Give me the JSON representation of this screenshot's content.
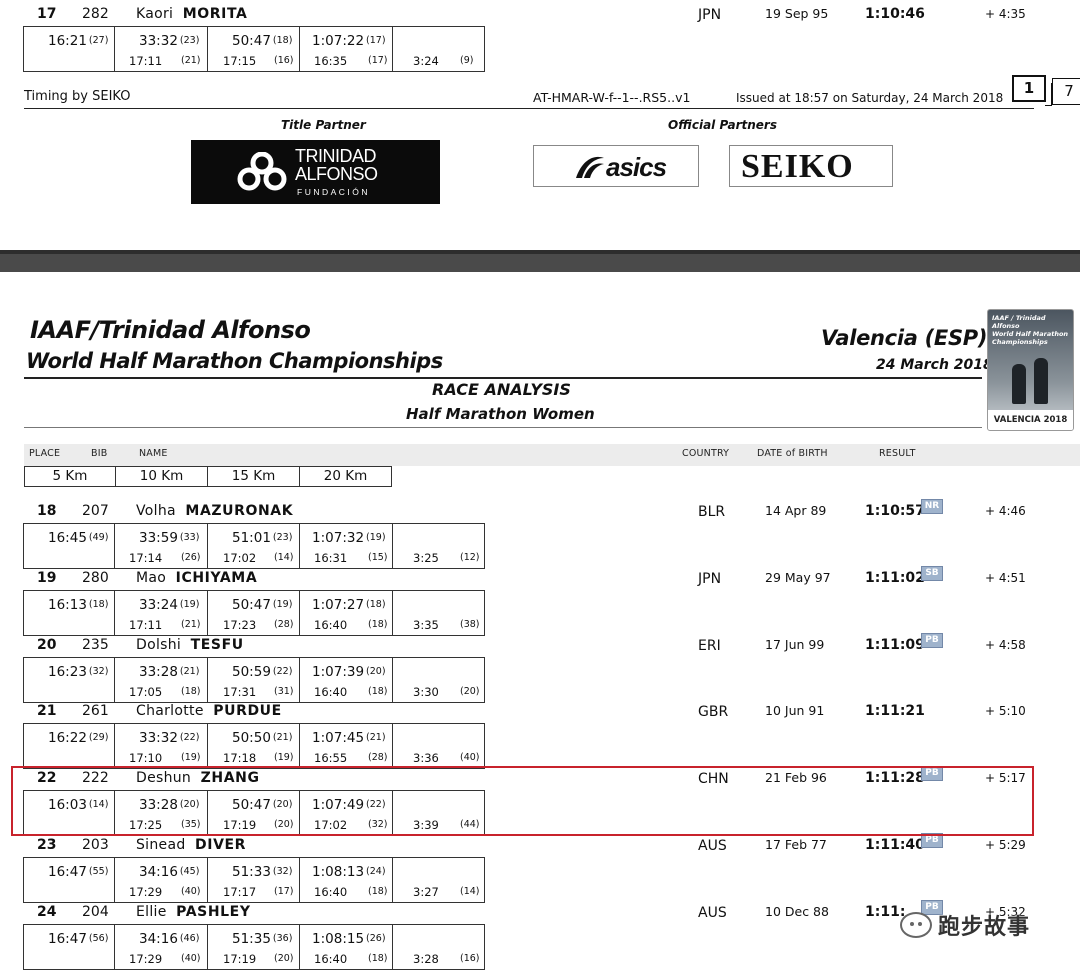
{
  "top_page": {
    "athlete": {
      "place": "17",
      "bib": "282",
      "first": "Kaori",
      "last": "MORITA",
      "country": "JPN",
      "dob": "19 Sep 95",
      "result": "1:10:46",
      "badge": "",
      "behind": "+ 4:35",
      "s5": "16:21",
      "r5": "(27)",
      "s10": "33:32",
      "r10": "(23)",
      "s15": "50:47",
      "r15": "(18)",
      "s20": "1:07:22",
      "r20": "(17)",
      "l10": "17:11",
      "lr10": "(21)",
      "l15": "17:15",
      "lr15": "(16)",
      "l20": "16:35",
      "lr20": "(17)",
      "lf": "3:24",
      "lrf": "(9)"
    },
    "footer": {
      "timing": "Timing by SEIKO",
      "doc_id": "AT-HMAR-W-f--1--.RS5..v1",
      "issued": "Issued at 18:57 on Saturday, 24 March  2018",
      "page": "1",
      "page_total": "7"
    },
    "partners": {
      "title_partner": "Title Partner",
      "official_partners": "Official Partners",
      "trinidad_line1": "TRINIDAD",
      "trinidad_line2": "ALFONSO",
      "trinidad_line3": "FUNDACIÓN",
      "asics": "asics",
      "seiko": "SEIKO"
    }
  },
  "header": {
    "title1": "IAAF/Trinidad Alfonso",
    "title2": "World Half Marathon Championships",
    "venue": "Valencia (ESP)",
    "date": "24 March 2018",
    "subtitle1": "RACE ANALYSIS",
    "subtitle2": "Half Marathon Women",
    "logo_text": "IAAF / Trinidad Alfonso World Half Marathon Championships",
    "logo_footer": "VALENCIA 2018"
  },
  "columns": {
    "place": "PLACE",
    "bib": "BIB",
    "name": "NAME",
    "country": "COUNTRY",
    "dob": "DATE of BIRTH",
    "result": "RESULT",
    "km5": "5 Km",
    "km10": "10 Km",
    "km15": "15 Km",
    "km20": "20 Km"
  },
  "athletes": [
    {
      "place": "18",
      "bib": "207",
      "first": "Volha",
      "last": "MAZURONAK",
      "country": "BLR",
      "dob": "14 Apr 89",
      "result": "1:10:57",
      "badge": "NR",
      "behind": "+ 4:46",
      "s5": "16:45",
      "r5": "(49)",
      "s10": "33:59",
      "r10": "(33)",
      "s15": "51:01",
      "r15": "(23)",
      "s20": "1:07:32",
      "r20": "(19)",
      "l10": "17:14",
      "lr10": "(26)",
      "l15": "17:02",
      "lr15": "(14)",
      "l20": "16:31",
      "lr20": "(15)",
      "lf": "3:25",
      "lrf": "(12)"
    },
    {
      "place": "19",
      "bib": "280",
      "first": "Mao",
      "last": "ICHIYAMA",
      "country": "JPN",
      "dob": "29 May 97",
      "result": "1:11:02",
      "badge": "SB",
      "behind": "+ 4:51",
      "s5": "16:13",
      "r5": "(18)",
      "s10": "33:24",
      "r10": "(19)",
      "s15": "50:47",
      "r15": "(19)",
      "s20": "1:07:27",
      "r20": "(18)",
      "l10": "17:11",
      "lr10": "(21)",
      "l15": "17:23",
      "lr15": "(28)",
      "l20": "16:40",
      "lr20": "(18)",
      "lf": "3:35",
      "lrf": "(38)"
    },
    {
      "place": "20",
      "bib": "235",
      "first": "Dolshi",
      "last": "TESFU",
      "country": "ERI",
      "dob": "17 Jun 99",
      "result": "1:11:09",
      "badge": "PB",
      "behind": "+ 4:58",
      "s5": "16:23",
      "r5": "(32)",
      "s10": "33:28",
      "r10": "(21)",
      "s15": "50:59",
      "r15": "(22)",
      "s20": "1:07:39",
      "r20": "(20)",
      "l10": "17:05",
      "lr10": "(18)",
      "l15": "17:31",
      "lr15": "(31)",
      "l20": "16:40",
      "lr20": "(18)",
      "lf": "3:30",
      "lrf": "(20)"
    },
    {
      "place": "21",
      "bib": "261",
      "first": "Charlotte",
      "last": "PURDUE",
      "country": "GBR",
      "dob": "10 Jun 91",
      "result": "1:11:21",
      "badge": "",
      "behind": "+ 5:10",
      "s5": "16:22",
      "r5": "(29)",
      "s10": "33:32",
      "r10": "(22)",
      "s15": "50:50",
      "r15": "(21)",
      "s20": "1:07:45",
      "r20": "(21)",
      "l10": "17:10",
      "lr10": "(19)",
      "l15": "17:18",
      "lr15": "(19)",
      "l20": "16:55",
      "lr20": "(28)",
      "lf": "3:36",
      "lrf": "(40)"
    },
    {
      "place": "22",
      "bib": "222",
      "first": "Deshun",
      "last": "ZHANG",
      "country": "CHN",
      "dob": "21 Feb 96",
      "result": "1:11:28",
      "badge": "PB",
      "behind": "+ 5:17",
      "s5": "16:03",
      "r5": "(14)",
      "s10": "33:28",
      "r10": "(20)",
      "s15": "50:47",
      "r15": "(20)",
      "s20": "1:07:49",
      "r20": "(22)",
      "l10": "17:25",
      "lr10": "(35)",
      "l15": "17:19",
      "lr15": "(20)",
      "l20": "17:02",
      "lr20": "(32)",
      "lf": "3:39",
      "lrf": "(44)"
    },
    {
      "place": "23",
      "bib": "203",
      "first": "Sinead",
      "last": "DIVER",
      "country": "AUS",
      "dob": "17 Feb 77",
      "result": "1:11:40",
      "badge": "PB",
      "behind": "+ 5:29",
      "s5": "16:47",
      "r5": "(55)",
      "s10": "34:16",
      "r10": "(45)",
      "s15": "51:33",
      "r15": "(32)",
      "s20": "1:08:13",
      "r20": "(24)",
      "l10": "17:29",
      "lr10": "(40)",
      "l15": "17:17",
      "lr15": "(17)",
      "l20": "16:40",
      "lr20": "(18)",
      "lf": "3:27",
      "lrf": "(14)"
    },
    {
      "place": "24",
      "bib": "204",
      "first": "Ellie",
      "last": "PASHLEY",
      "country": "AUS",
      "dob": "10 Dec 88",
      "result": "1:11:",
      "badge": "PB",
      "behind": "+ 5:32",
      "s5": "16:47",
      "r5": "(56)",
      "s10": "34:16",
      "r10": "(46)",
      "s15": "51:35",
      "r15": "(36)",
      "s20": "1:08:15",
      "r20": "(26)",
      "l10": "17:29",
      "lr10": "(40)",
      "l15": "17:19",
      "lr15": "(20)",
      "l20": "16:40",
      "lr20": "(18)",
      "lf": "3:28",
      "lrf": "(16)"
    }
  ],
  "watermark": "跑步故事"
}
